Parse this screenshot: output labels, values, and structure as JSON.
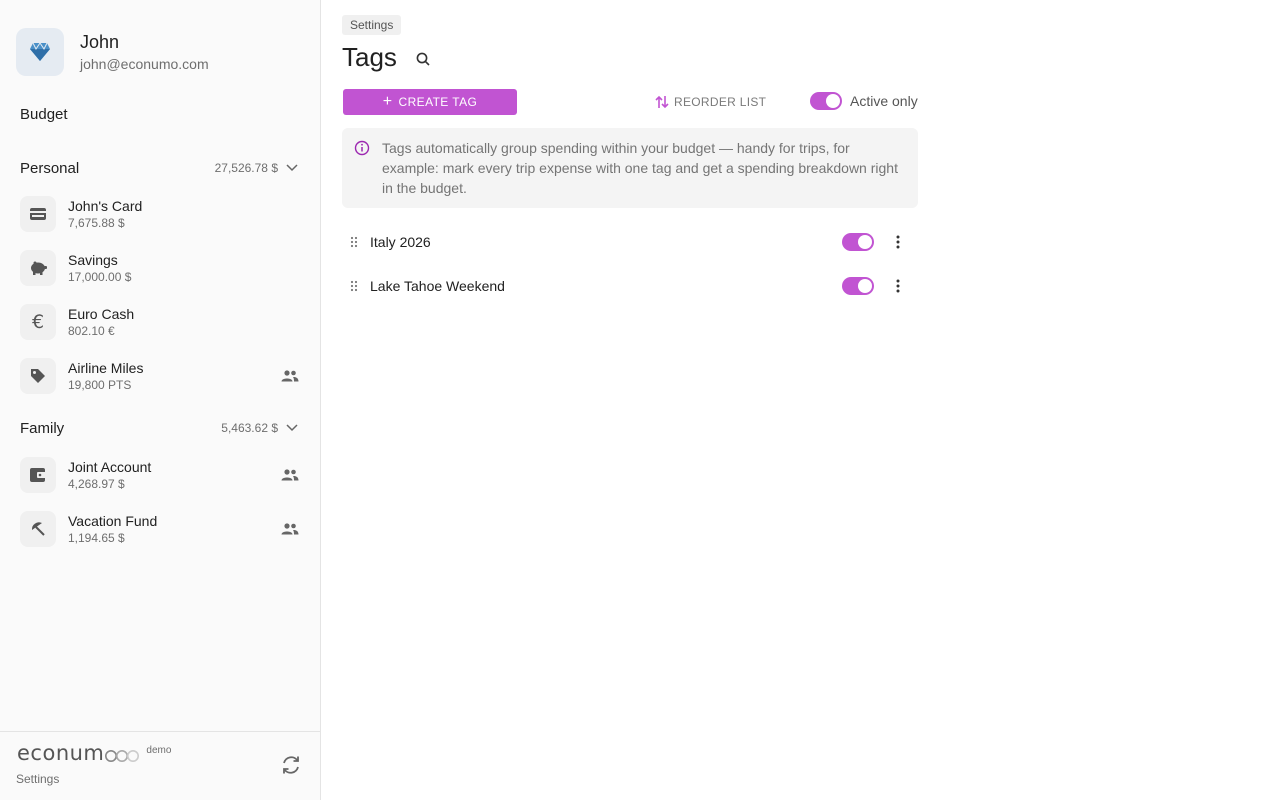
{
  "user": {
    "name": "John",
    "email": "john@econumo.com"
  },
  "nav": {
    "budget_label": "Budget"
  },
  "groups": [
    {
      "title": "Personal",
      "total": "27,526.78 $",
      "accounts": [
        {
          "name": "John's Card",
          "balance": "7,675.88 $",
          "icon": "credit-card-icon",
          "shared": false
        },
        {
          "name": "Savings",
          "balance": "17,000.00 $",
          "icon": "piggy-bank-icon",
          "shared": false
        },
        {
          "name": "Euro Cash",
          "balance": "802.10 €",
          "icon": "euro-icon",
          "shared": false
        },
        {
          "name": "Airline Miles",
          "balance": "19,800 PTS",
          "icon": "tag-icon",
          "shared": true
        }
      ]
    },
    {
      "title": "Family",
      "total": "5,463.62 $",
      "accounts": [
        {
          "name": "Joint Account",
          "balance": "4,268.97 $",
          "icon": "wallet-icon",
          "shared": true
        },
        {
          "name": "Vacation Fund",
          "balance": "1,194.65 $",
          "icon": "beach-umbrella-icon",
          "shared": true
        }
      ]
    }
  ],
  "footer": {
    "logo_text": "econum",
    "logo_badge": "demo",
    "settings_label": "Settings"
  },
  "main": {
    "breadcrumb": "Settings",
    "title": "Tags",
    "create_label": "CREATE TAG",
    "reorder_label": "REORDER LIST",
    "active_only_label": "Active only",
    "active_only_on": true,
    "info_text": "Tags automatically group spending within your budget — handy for trips, for example: mark every trip expense with one tag and get a spending breakdown right in the budget.",
    "tags": [
      {
        "name": "Italy 2026",
        "active": true
      },
      {
        "name": "Lake Tahoe Weekend",
        "active": true
      }
    ]
  },
  "colors": {
    "accent": "#c154d2",
    "sidebar_bg": "#fafafa",
    "info_bg": "#f4f4f4"
  }
}
